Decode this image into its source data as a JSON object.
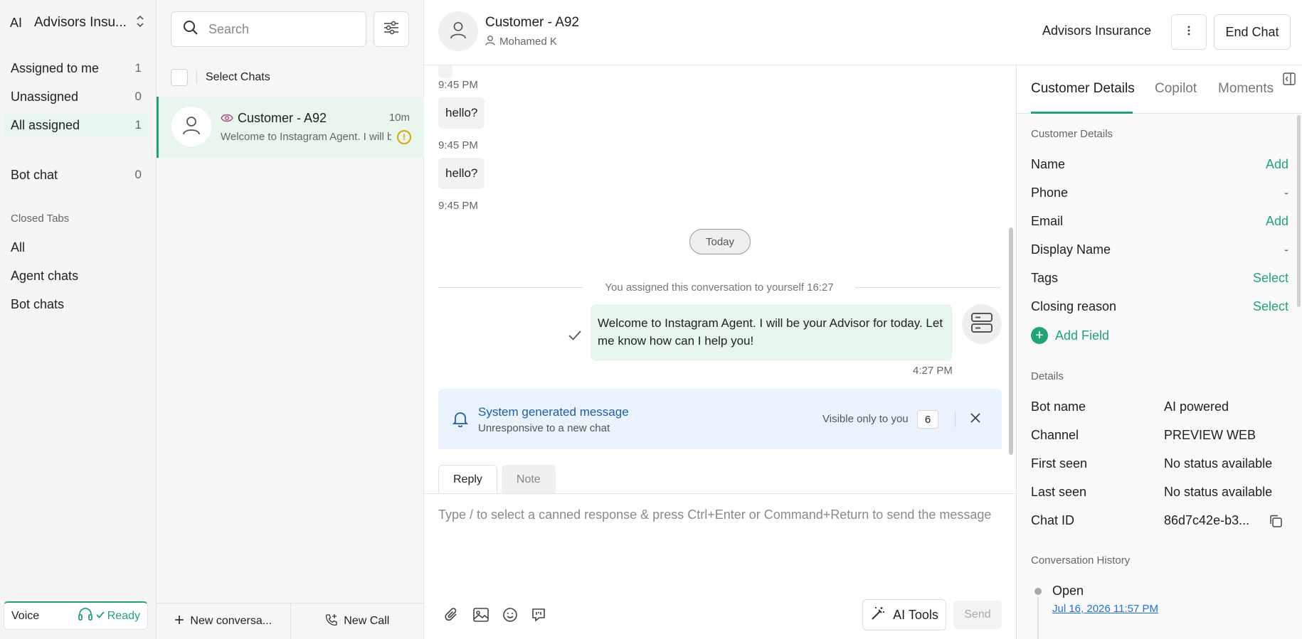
{
  "workspace": {
    "avatar": "AI",
    "name": "Advisors Insu..."
  },
  "nav": {
    "assigned_to_me": {
      "label": "Assigned to me",
      "count": "1"
    },
    "unassigned": {
      "label": "Unassigned",
      "count": "0"
    },
    "all_assigned": {
      "label": "All assigned",
      "count": "1"
    },
    "bot_chat": {
      "label": "Bot chat",
      "count": "0"
    },
    "closed_tabs_heading": "Closed Tabs",
    "closed_all": "All",
    "agent_chats": "Agent chats",
    "bot_chats": "Bot chats"
  },
  "voice": {
    "label": "Voice",
    "status": "Ready"
  },
  "chatlist": {
    "search_placeholder": "Search",
    "select_chats": "Select Chats",
    "items": [
      {
        "name": "Customer - A92",
        "time": "10m",
        "preview": "Welcome to Instagram Agent. I will be your Advisor for today"
      }
    ],
    "new_conversation": "New conversa...",
    "new_call": "New Call"
  },
  "conversation": {
    "title": "Customer - A92",
    "agent": "Mohamed K",
    "org": "Advisors Insurance",
    "end_chat": "End Chat",
    "messages": [
      {
        "text": "hello?",
        "time": "9:45 PM"
      },
      {
        "text": "hello?",
        "time": "9:45 PM"
      }
    ],
    "first_time": "9:45 PM",
    "day_separator": "Today",
    "assign_event": "You assigned this conversation to yourself   16:27",
    "outgoing": {
      "text": "Welcome to Instagram Agent. I will be your Advisor for today. Let me know how can I help you!",
      "time": "4:27 PM"
    },
    "system": {
      "title": "System generated message",
      "subtitle": "Unresponsive to a new chat",
      "visibility": "Visible only to you",
      "count": "6"
    },
    "tabs": {
      "reply": "Reply",
      "note": "Note"
    },
    "composer_placeholder": "Type / to select a canned response & press Ctrl+Enter or Command+Return to send the message",
    "ai_tools": "AI Tools",
    "send": "Send"
  },
  "right_panel": {
    "tabs": [
      "Customer Details",
      "Copilot",
      "Moments"
    ],
    "customer_details_heading": "Customer Details",
    "fields": [
      {
        "label": "Name",
        "value": "Add",
        "kind": "action"
      },
      {
        "label": "Phone",
        "value": "-",
        "kind": "value"
      },
      {
        "label": "Email",
        "value": "Add",
        "kind": "action"
      },
      {
        "label": "Display Name",
        "value": "-",
        "kind": "value"
      },
      {
        "label": "Tags",
        "value": "Select",
        "kind": "action"
      },
      {
        "label": "Closing reason",
        "value": "Select",
        "kind": "action"
      }
    ],
    "add_field": "Add Field",
    "details_heading": "Details",
    "details": [
      {
        "label": "Bot name",
        "value": "AI powered"
      },
      {
        "label": "Channel",
        "value": "PREVIEW WEB"
      },
      {
        "label": "First seen",
        "value": "No status available"
      },
      {
        "label": "Last seen",
        "value": "No status available"
      },
      {
        "label": "Chat ID",
        "value": "86d7c42e-b3..."
      }
    ],
    "history_heading": "Conversation History",
    "history": [
      {
        "status": "Open",
        "date": "Jul 16, 2026 11:57 PM"
      }
    ]
  },
  "colors": {
    "accent": "#1ea672",
    "system_bg": "#e9f2fd",
    "link": "#1a73e8"
  }
}
